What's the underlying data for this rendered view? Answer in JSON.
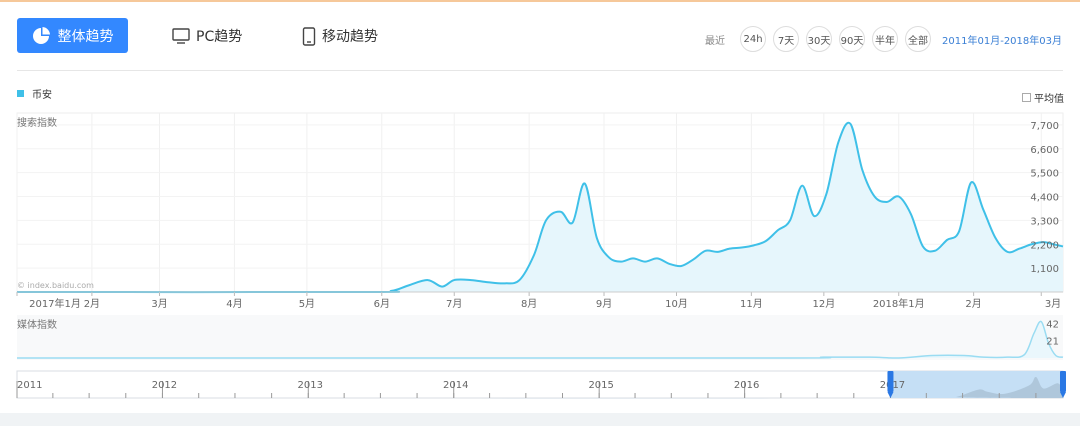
{
  "toolbar": {
    "overall_label": "整体趋势",
    "pc_label": "PC趋势",
    "mobile_label": "移动趋势",
    "recent_label": "最近",
    "ranges": [
      "24h",
      "7天",
      "30天",
      "90天",
      "半年",
      "全部"
    ],
    "date_range": "2011年01月-2018年03月"
  },
  "legend": {
    "series_name": "币安",
    "avg_label": "平均值"
  },
  "colors": {
    "accent": "#3388ff",
    "series": "#3fc0e8",
    "fill": "#e6f6fc"
  },
  "chart_data": [
    {
      "type": "area",
      "ylabel": "搜索指数",
      "watermark": "© index.baidu.com",
      "y_ticks": [
        "1,100",
        "2,200",
        "3,300",
        "4,400",
        "5,500",
        "6,600",
        "7,700"
      ],
      "ylim": [
        0,
        8250
      ],
      "x_ticks": [
        "2017年1月",
        "2月",
        "3月",
        "4月",
        "5月",
        "6月",
        "7月",
        "8月",
        "9月",
        "10月",
        "11月",
        "12月",
        "2018年1月",
        "2月",
        "3月"
      ],
      "xlim": [
        "2017-01-01",
        "2018-03-10"
      ],
      "series": [
        {
          "name": "币安",
          "x": [
            "2017-01-01",
            "2017-05-25",
            "2017-06-05",
            "2017-06-12",
            "2017-06-20",
            "2017-06-26",
            "2017-07-01",
            "2017-07-08",
            "2017-07-15",
            "2017-07-22",
            "2017-07-28",
            "2017-08-03",
            "2017-08-08",
            "2017-08-14",
            "2017-08-19",
            "2017-08-24",
            "2017-08-29",
            "2017-09-03",
            "2017-09-08",
            "2017-09-13",
            "2017-09-18",
            "2017-09-23",
            "2017-09-28",
            "2017-10-03",
            "2017-10-08",
            "2017-10-13",
            "2017-10-18",
            "2017-10-23",
            "2017-10-28",
            "2017-11-02",
            "2017-11-07",
            "2017-11-12",
            "2017-11-17",
            "2017-11-22",
            "2017-11-27",
            "2017-12-02",
            "2017-12-07",
            "2017-12-12",
            "2017-12-17",
            "2017-12-22",
            "2017-12-27",
            "2018-01-01",
            "2018-01-06",
            "2018-01-11",
            "2018-01-16",
            "2018-01-21",
            "2018-01-26",
            "2018-01-31",
            "2018-02-05",
            "2018-02-10",
            "2018-02-15",
            "2018-02-20",
            "2018-02-25",
            "2018-03-02",
            "2018-03-06",
            "2018-03-10"
          ],
          "values": [
            0,
            0,
            50,
            300,
            550,
            250,
            550,
            550,
            450,
            400,
            550,
            1700,
            3300,
            3700,
            3200,
            5000,
            2500,
            1600,
            1400,
            1550,
            1400,
            1550,
            1300,
            1200,
            1500,
            1900,
            1850,
            2000,
            2050,
            2150,
            2350,
            2850,
            3300,
            4900,
            3500,
            4500,
            6900,
            7750,
            5600,
            4400,
            4150,
            4400,
            3600,
            2100,
            1900,
            2400,
            2800,
            5050,
            3800,
            2500,
            1850,
            2000,
            2200,
            2300,
            2200,
            2100
          ]
        }
      ]
    },
    {
      "type": "area",
      "ylabel": "媒体指数",
      "y_ticks": [
        "21",
        "42"
      ],
      "ylim": [
        0,
        46
      ],
      "xlim": [
        "2017-01-01",
        "2018-03-10"
      ],
      "series": [
        {
          "name": "币安",
          "x": [
            "2017-01-01",
            "2017-11-01",
            "2017-12-01",
            "2017-12-20",
            "2018-01-01",
            "2018-01-15",
            "2018-01-28",
            "2018-02-05",
            "2018-02-15",
            "2018-02-22",
            "2018-02-26",
            "2018-03-01",
            "2018-03-04",
            "2018-03-07",
            "2018-03-10"
          ],
          "values": [
            0,
            0,
            1,
            1,
            0,
            3,
            3,
            1,
            1,
            4,
            30,
            44,
            18,
            3,
            1
          ]
        }
      ]
    },
    {
      "type": "area",
      "x_ticks": [
        "2011",
        "2012",
        "2013",
        "2014",
        "2015",
        "2016",
        "2017"
      ],
      "xlim": [
        "2011-01-01",
        "2018-03-10"
      ],
      "selection": [
        "2017-01-01",
        "2018-03-10"
      ],
      "series": [
        {
          "x": [
            "2011-01-01",
            "2017-05-01",
            "2017-06-15",
            "2017-08-10",
            "2017-09-01",
            "2017-10-15",
            "2017-12-15",
            "2018-01-01",
            "2018-01-20",
            "2018-02-25",
            "2018-03-10"
          ],
          "values": [
            0,
            0,
            0.05,
            0.4,
            0.3,
            0.2,
            0.6,
            1.0,
            0.45,
            0.7,
            0.3
          ]
        }
      ]
    }
  ]
}
